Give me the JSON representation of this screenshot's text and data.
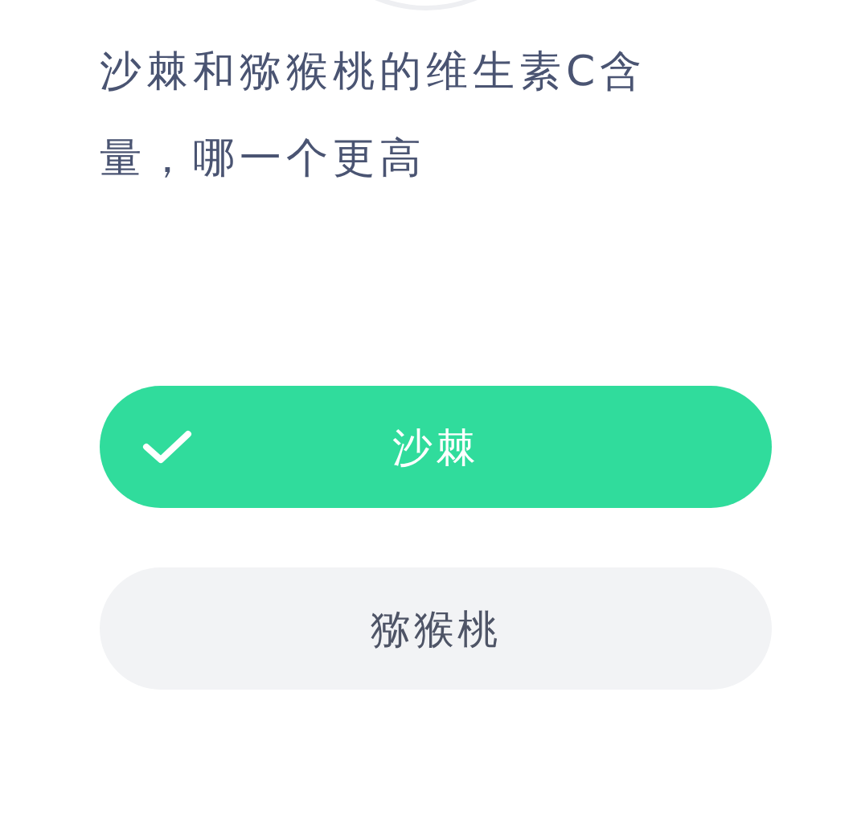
{
  "question": "沙棘和猕猴桃的维生素C含量，哪一个更高",
  "options": [
    {
      "label": "沙棘",
      "selected": true
    },
    {
      "label": "猕猴桃",
      "selected": false
    }
  ]
}
